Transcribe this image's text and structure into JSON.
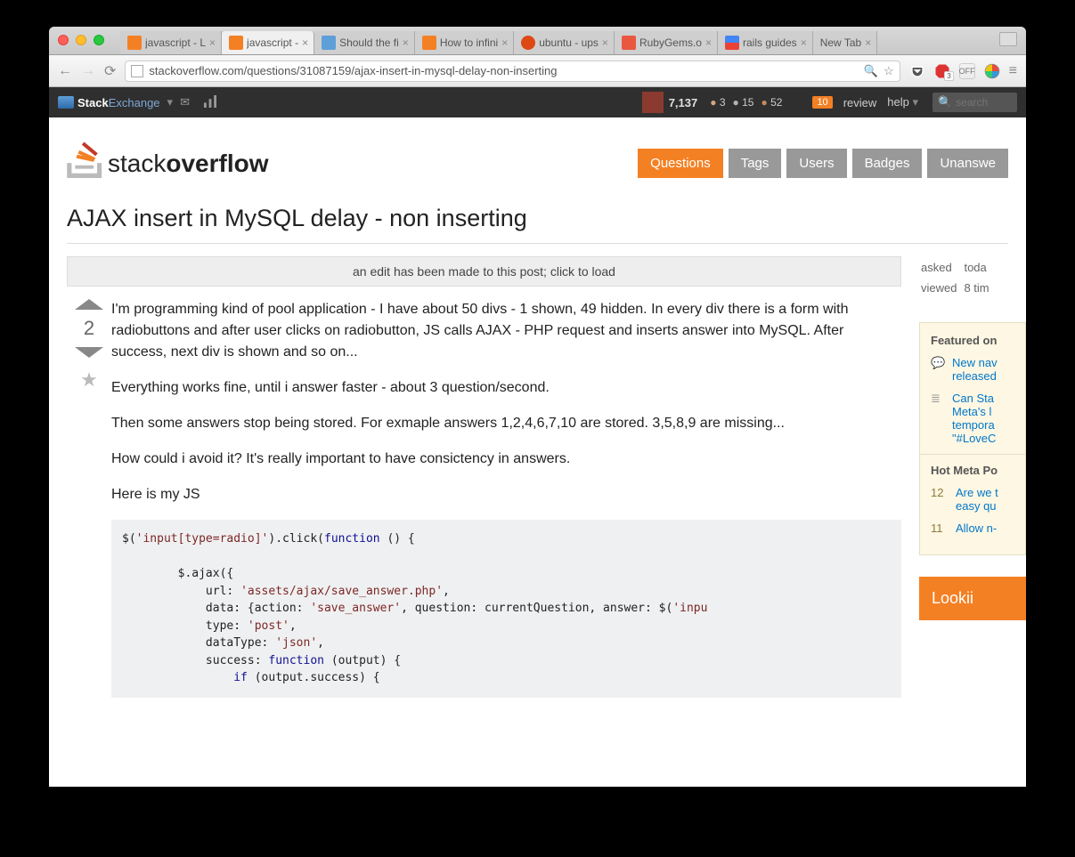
{
  "browser": {
    "tabs": [
      {
        "title": "javascript - L"
      },
      {
        "title": "javascript -",
        "active": true
      },
      {
        "title": "Should the fi"
      },
      {
        "title": "How to infini"
      },
      {
        "title": "ubuntu - ups"
      },
      {
        "title": "RubyGems.o"
      },
      {
        "title": "rails guides"
      },
      {
        "title": "New Tab"
      }
    ],
    "url": "stackoverflow.com/questions/31087159/ajax-insert-in-mysql-delay-non-inserting",
    "adblock_count": "3",
    "off_label": "OFF"
  },
  "sebar": {
    "brand1": "Stack",
    "brand2": "Exchange",
    "rep": "7,137",
    "gold": "3",
    "silver": "15",
    "bronze": "52",
    "review_count": "10",
    "review": "review",
    "help": "help",
    "search_ph": "search"
  },
  "nav": {
    "questions": "Questions",
    "tags": "Tags",
    "users": "Users",
    "badges": "Badges",
    "unanswered": "Unanswe"
  },
  "logo": {
    "part1": "stack",
    "part2": "overflow"
  },
  "question": {
    "title": "AJAX insert in MySQL delay - non inserting",
    "edit_notice": "an edit has been made to this post; click to load",
    "score": "2",
    "body": {
      "p1": "I'm programming kind of pool application - I have about 50 divs - 1 shown, 49 hidden. In every div there is a form with radiobuttons and after user clicks on radiobutton, JS calls AJAX - PHP request and inserts answer into MySQL. After success, next div is shown and so on...",
      "p2": "Everything works fine, until i answer faster - about 3 question/second.",
      "p3": "Then some answers stop being stored. For exmaple answers 1,2,4,6,7,10 are stored. 3,5,8,9 are missing...",
      "p4": "How could i avoid it? It's really important to have consictency in answers.",
      "p5": "Here is my JS"
    }
  },
  "sidebar": {
    "asked_l": "asked",
    "asked_v": "toda",
    "viewed_l": "viewed",
    "viewed_v": "8 tim",
    "featured_h": "Featured on",
    "f1": "New nav",
    "f2a": "released",
    "f3a": "Can Sta",
    "f3b": "Meta's l",
    "f3c": "tempora",
    "f3d": "\"#LoveC",
    "hot_h": "Hot Meta Po",
    "h1n": "12",
    "h1a": "Are we t",
    "h1b": "easy qu",
    "h2n": "11",
    "h2a": "Allow n-",
    "looking": "Lookii"
  }
}
